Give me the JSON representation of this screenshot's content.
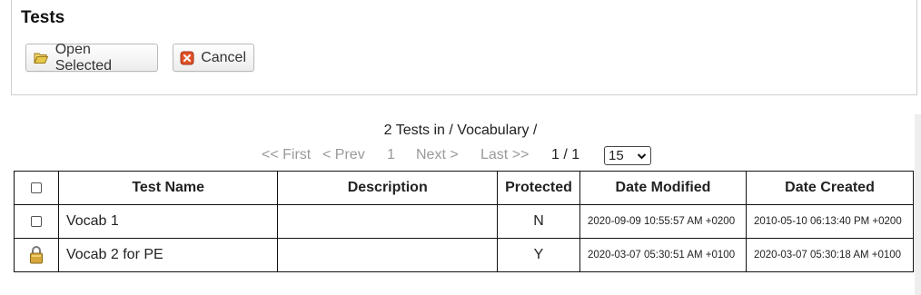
{
  "panel": {
    "title": "Tests",
    "open_label": "Open Selected",
    "cancel_label": "Cancel"
  },
  "summary": "2 Tests in / Vocabulary /",
  "pager": {
    "first": "<< First",
    "prev": "< Prev",
    "page": "1",
    "next": "Next >",
    "last": "Last >>",
    "page_of": "1 / 1",
    "per_page": "15"
  },
  "table": {
    "headers": [
      "Test Name",
      "Description",
      "Protected",
      "Date Modified",
      "Date Created"
    ],
    "rows": [
      {
        "name": "Vocab 1",
        "description": "",
        "protected": "N",
        "modified": "2020-09-09 10:55:57 AM +0200",
        "created": "2010-05-10 06:13:40 PM +0200",
        "icon": "checkbox"
      },
      {
        "name": "Vocab 2 for PE",
        "description": "",
        "protected": "Y",
        "modified": "2020-03-07 05:30:51 AM +0100",
        "created": "2020-03-07 05:30:18 AM +0100",
        "icon": "lock-icon"
      }
    ]
  },
  "colors": {
    "folder": "#e8c84a",
    "cancel": "#e0532a",
    "lock": "#d6a73a"
  }
}
